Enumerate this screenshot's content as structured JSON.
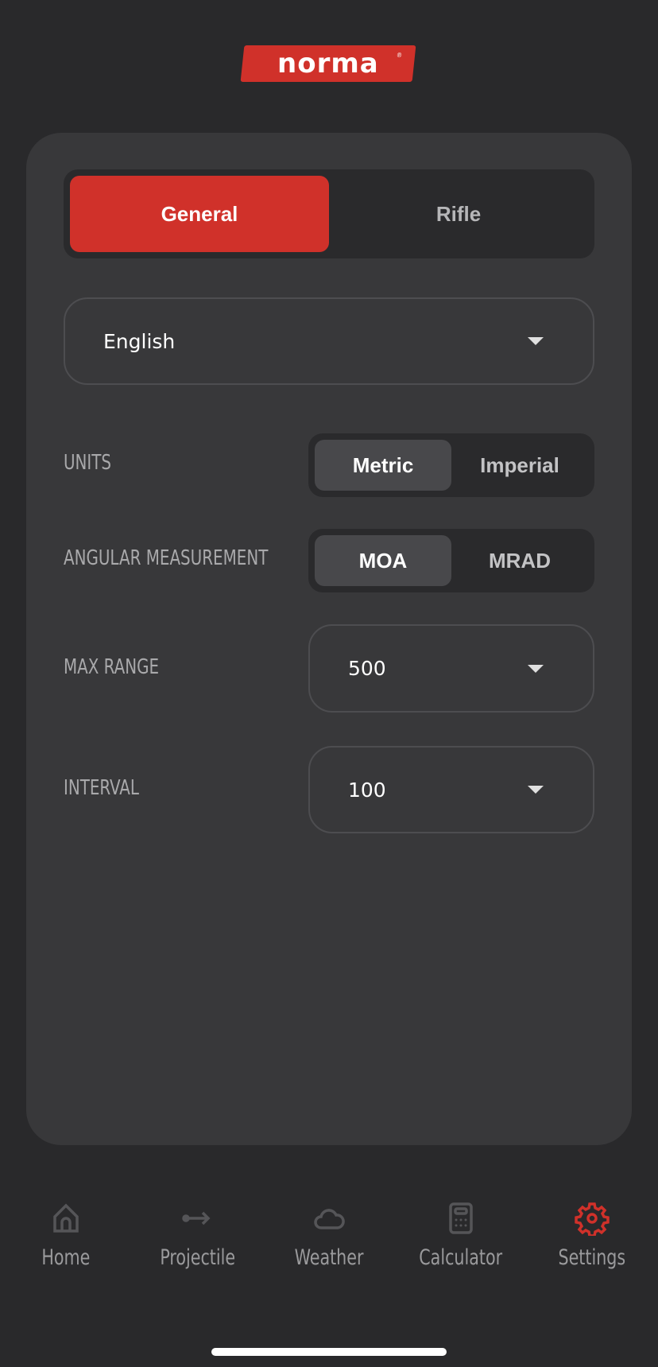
{
  "brand": {
    "logo_text": "norma",
    "color": "#d0312a"
  },
  "tabs": [
    {
      "label": "General",
      "active": true
    },
    {
      "label": "Rifle",
      "active": false
    }
  ],
  "language": {
    "value": "English"
  },
  "settings": {
    "units": {
      "label": "UNITS",
      "options": [
        "Metric",
        "Imperial"
      ],
      "selected": "Metric"
    },
    "angular": {
      "label": "ANGULAR MEASUREMENT",
      "options": [
        "MOA",
        "MRAD"
      ],
      "selected": "MOA"
    },
    "max_range": {
      "label": "MAX RANGE",
      "value": "500"
    },
    "interval": {
      "label": "INTERVAL",
      "value": "100"
    }
  },
  "nav": [
    {
      "label": "Home",
      "icon": "home-icon"
    },
    {
      "label": "Projectile",
      "icon": "projectile-icon"
    },
    {
      "label": "Weather",
      "icon": "cloud-icon"
    },
    {
      "label": "Calculator",
      "icon": "calculator-icon"
    },
    {
      "label": "Settings",
      "icon": "gear-icon",
      "active": true
    }
  ]
}
